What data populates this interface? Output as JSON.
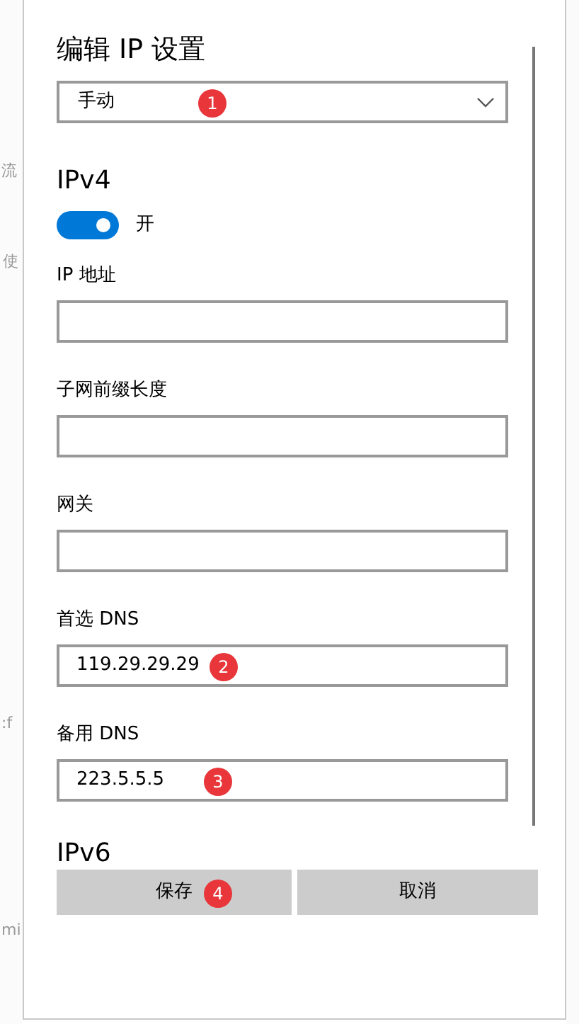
{
  "background_texts": [
    "流",
    "使",
    ":f",
    "mi"
  ],
  "dialog": {
    "title": "编辑 IP 设置",
    "mode_dropdown": {
      "value": "手动",
      "badge": "1"
    },
    "ipv4": {
      "heading": "IPv4",
      "toggle": {
        "on": true,
        "label": "开"
      },
      "fields": [
        {
          "label": "IP 地址"
        },
        {
          "label": "子网前缀长度"
        },
        {
          "label": "网关"
        },
        {
          "label": "首选 DNS",
          "value": "119.29.29.29",
          "badge": "2"
        },
        {
          "label": "备用 DNS",
          "value": "223.5.5.5",
          "badge": "3"
        }
      ]
    },
    "ipv6": {
      "heading": "IPv6"
    },
    "buttons": [
      {
        "label": "保存",
        "badge": "4"
      },
      {
        "label": "取消"
      }
    ]
  }
}
